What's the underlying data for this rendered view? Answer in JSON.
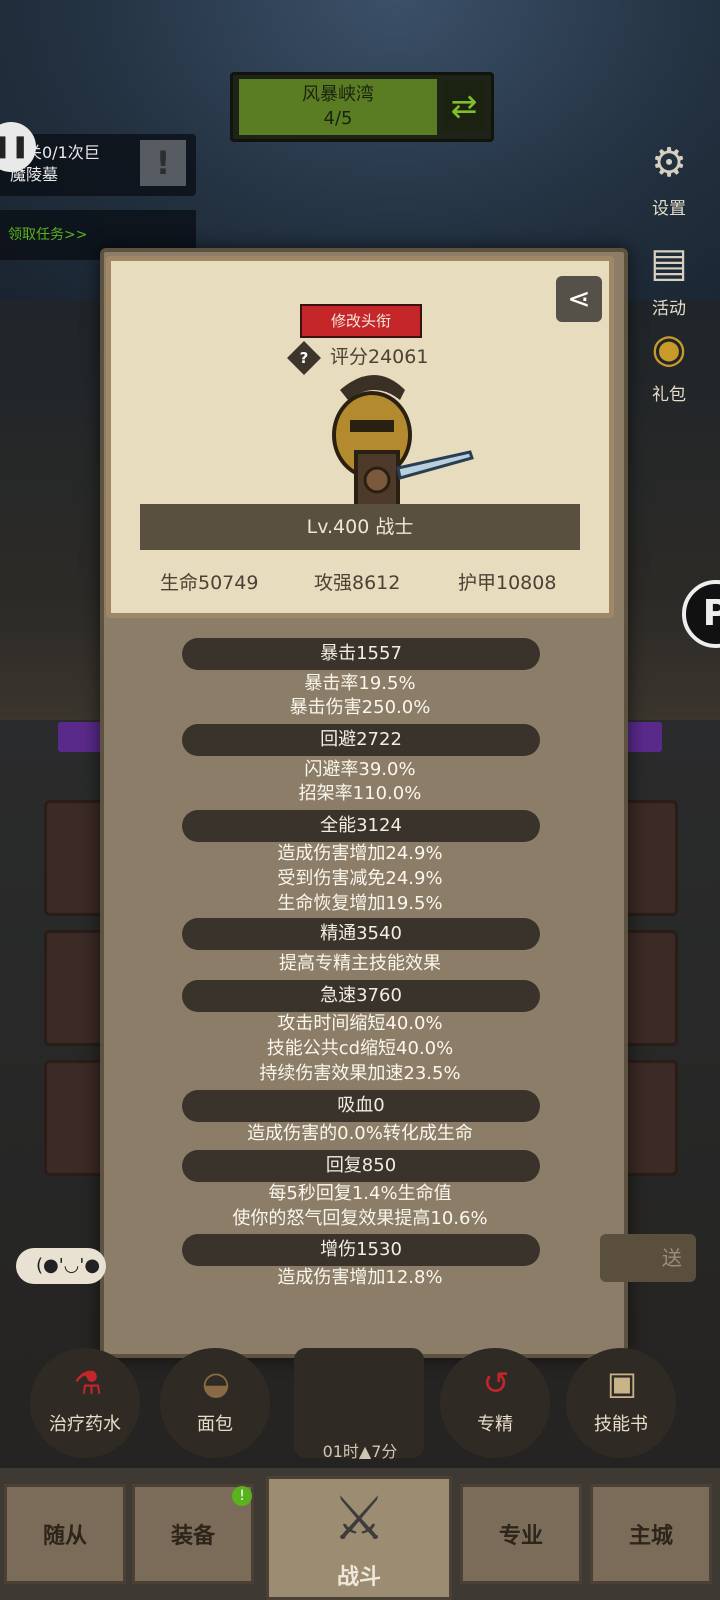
{
  "stage": {
    "name": "风暴峡湾",
    "progress": "4/5",
    "swap_icon": "refresh-icon"
  },
  "quest": {
    "line1": "通关0/1次巨",
    "line2": "魔陵墓",
    "accept": "领取任务>>"
  },
  "right_menu": [
    {
      "label": "设置",
      "icon": "gear-icon"
    },
    {
      "label": "活动",
      "icon": "calendar-icon"
    },
    {
      "label": "礼包",
      "icon": "gift-icon"
    }
  ],
  "panel": {
    "change_title_button": "修改头衔",
    "help": "?",
    "score": "评分24061",
    "level_class": "Lv.400 战士",
    "base_stats": [
      "生命50749",
      "攻强8612",
      "护甲10808"
    ]
  },
  "stats": [
    {
      "header": "暴击1557",
      "lines": [
        "暴击率19.5%",
        "暴击伤害250.0%"
      ]
    },
    {
      "header": "回避2722",
      "lines": [
        "闪避率39.0%",
        "招架率110.0%"
      ]
    },
    {
      "header": "全能3124",
      "lines": [
        "造成伤害增加24.9%",
        "受到伤害减免24.9%",
        "生命恢复增加19.5%"
      ]
    },
    {
      "header": "精通3540",
      "lines": [
        "提高专精主技能效果"
      ]
    },
    {
      "header": "急速3760",
      "lines": [
        "攻击时间缩短40.0%",
        "技能公共cd缩短40.0%",
        "持续伤害效果加速23.5%"
      ]
    },
    {
      "header": "吸血0",
      "lines": [
        "造成伤害的0.0%转化成生命"
      ]
    },
    {
      "header": "回复850",
      "lines": [
        "每5秒回复1.4%生命值",
        "使你的怒气回复效果提高10.6%"
      ]
    },
    {
      "header": "增伤1530",
      "lines": [
        "造成伤害增加12.8%"
      ]
    }
  ],
  "bottom": {
    "chat_emote": "(●'◡'●",
    "send_label": "送",
    "skills": [
      "治疗药水",
      "面包",
      "专精",
      "技能书"
    ],
    "timer": "01时▲7分"
  },
  "nav": {
    "tabs": [
      "随从",
      "装备",
      "战斗",
      "专业",
      "主城"
    ],
    "badge": "!"
  },
  "colors": {
    "accent_red": "#c4262a",
    "panel_bg": "#8b7d68",
    "parchment": "#e8dcbe",
    "green": "#5a7c22"
  }
}
